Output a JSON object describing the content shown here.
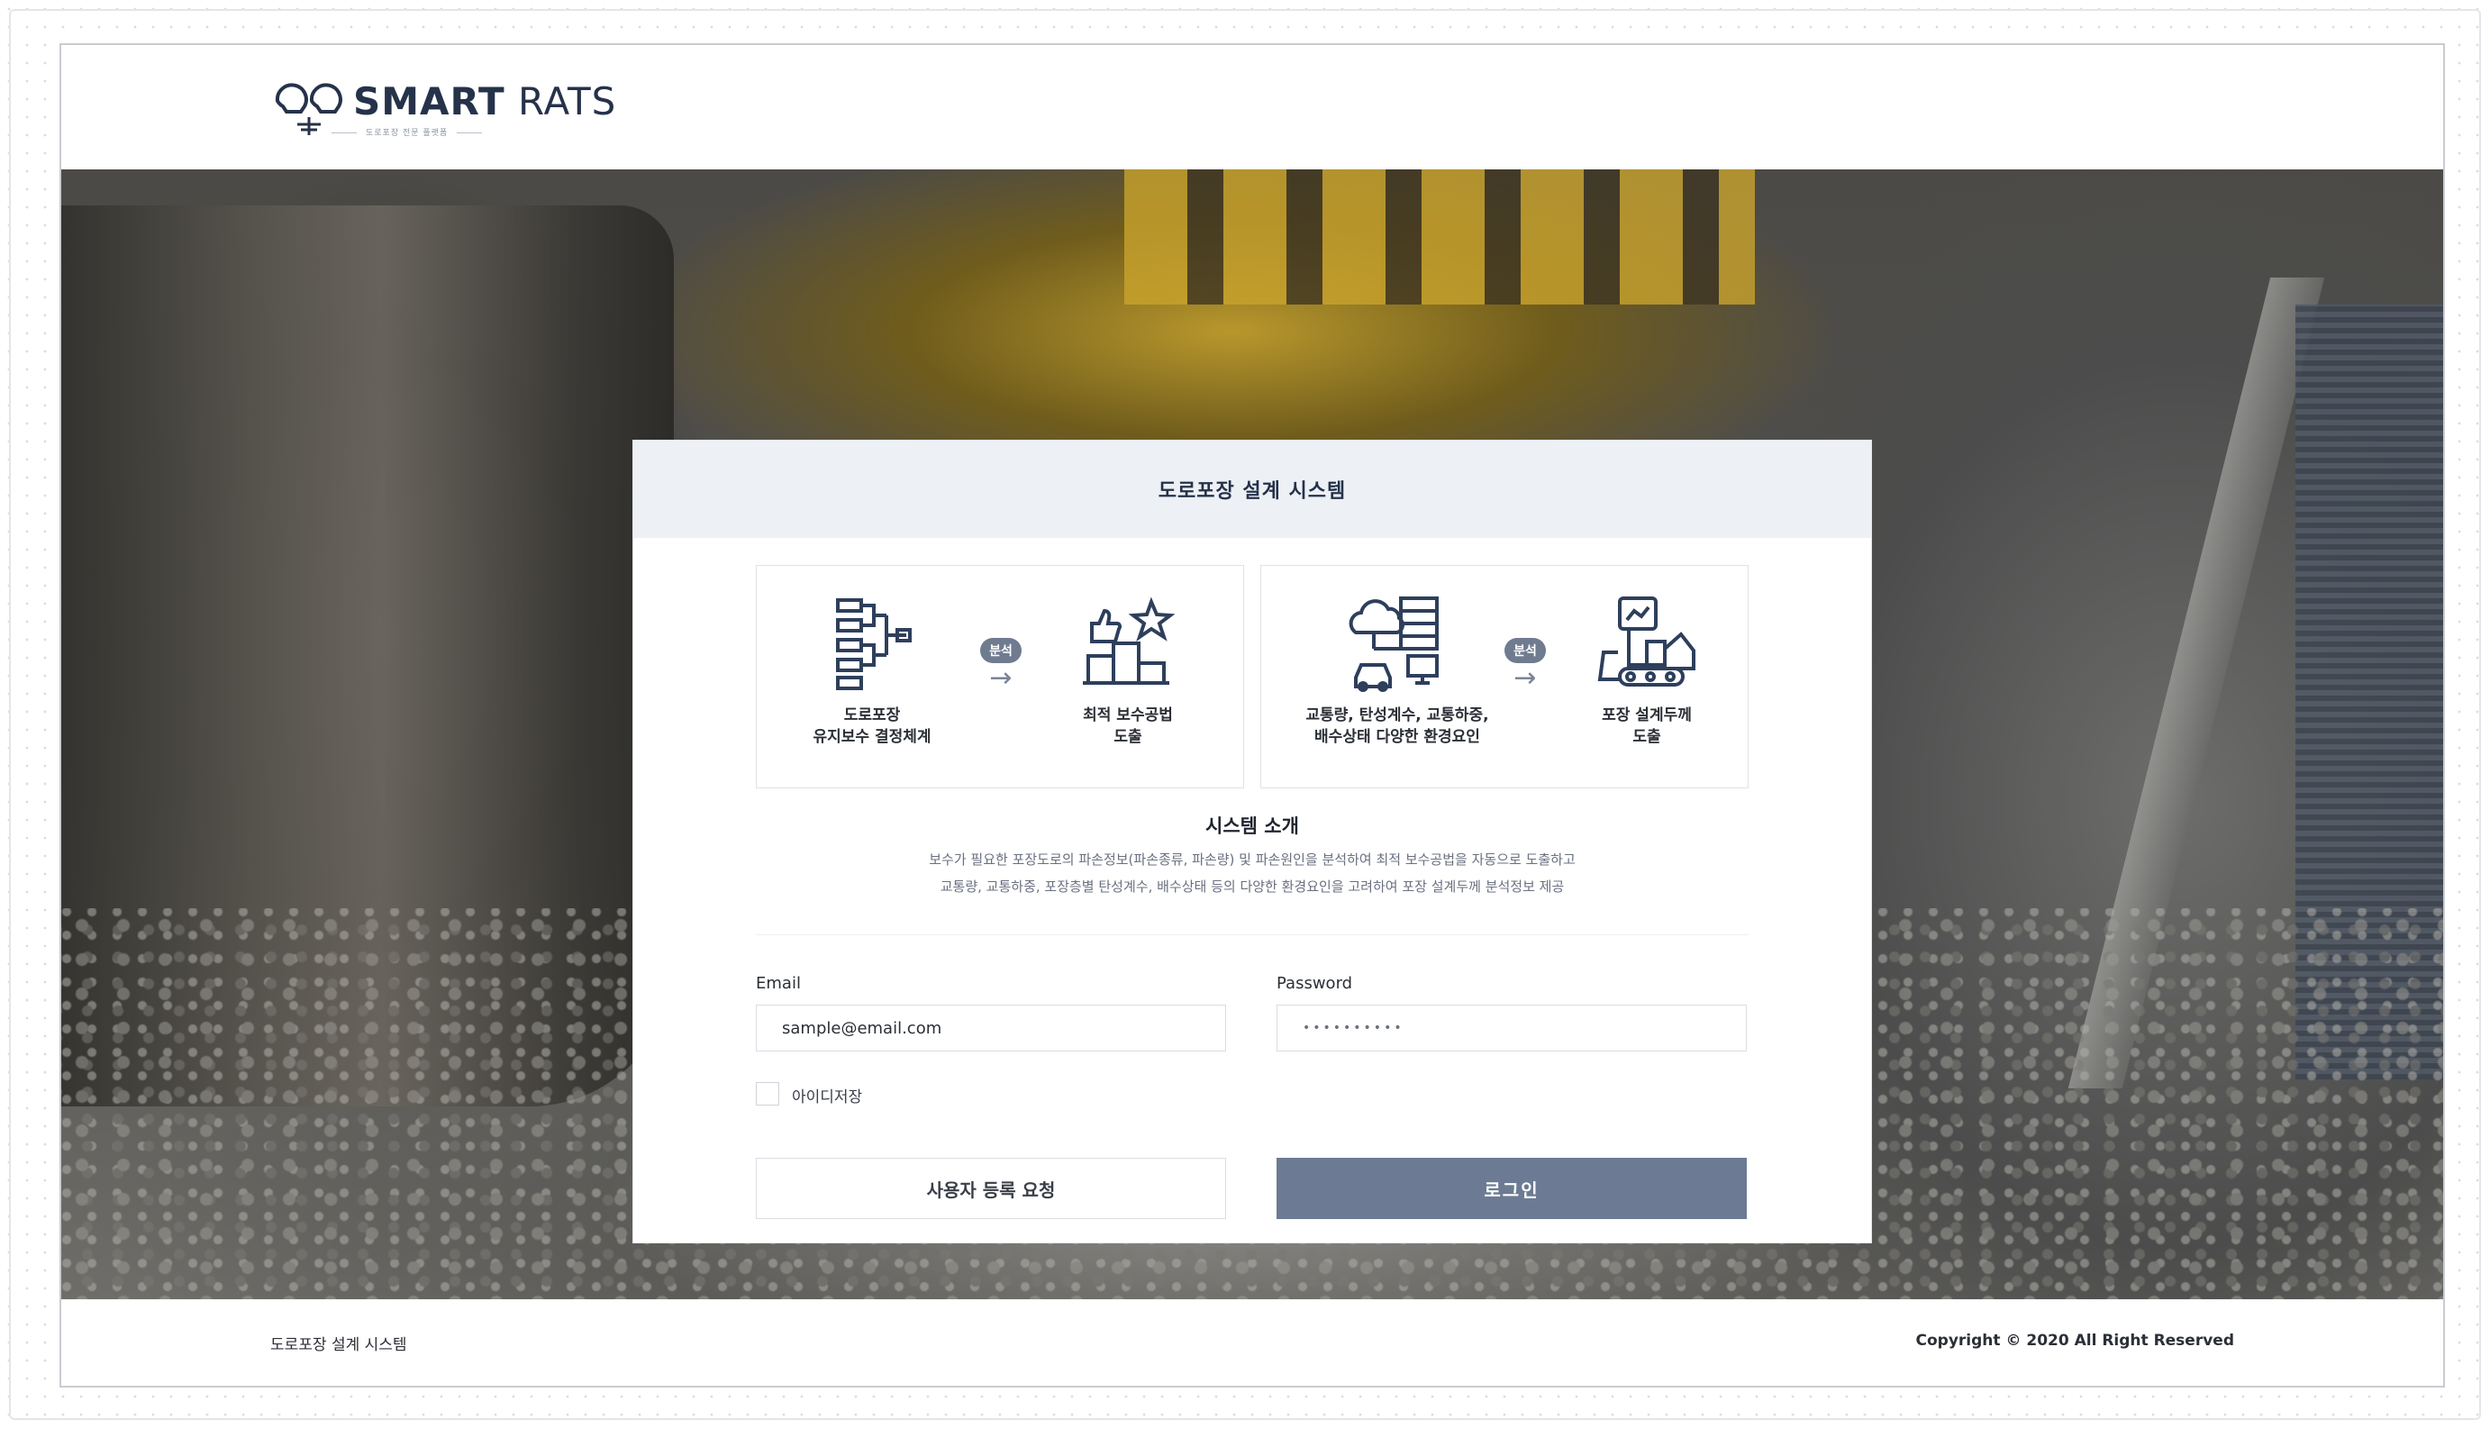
{
  "brand": {
    "name_bold": "SMART",
    "name_light": "RATS",
    "tagline": "도로포장 전문 플랫폼"
  },
  "card": {
    "title": "도로포장 설계 시스템",
    "flows": [
      {
        "from": {
          "icon": "hierarchy-chart-icon",
          "caption_1": "도로포장",
          "caption_2": "유지보수 결정체계"
        },
        "arrow_label": "분석",
        "to": {
          "icon": "podium-star-icon",
          "caption_1": "최적 보수공법",
          "caption_2": "도출"
        }
      },
      {
        "from": {
          "icon": "cloud-server-car-icon",
          "caption_1": "교통량, 탄성계수, 교통하중,",
          "caption_2": "배수상태 다양한 환경요인"
        },
        "arrow_label": "분석",
        "to": {
          "icon": "bulldozer-icon",
          "caption_1": "포장 설계두께",
          "caption_2": "도출"
        }
      }
    ],
    "intro": {
      "title": "시스템 소개",
      "line_1": "보수가 필요한 포장도로의 파손정보(파손종류, 파손량) 및 파손원인을 분석하여 최적 보수공법을 자동으로 도출하고",
      "line_2": "교통량, 교통하중, 포장층별 탄성계수, 배수상태 등의 다양한 환경요인을 고려하여 포장 설계두께 분석정보 제공"
    },
    "form": {
      "email_label": "Email",
      "email_value": "sample@email.com",
      "password_label": "Password",
      "password_value": "••••••••••",
      "remember_label": "아이디저장",
      "remember_checked": false,
      "register_button": "사용자 등록 요청",
      "login_button": "로그인"
    }
  },
  "footer": {
    "left": "도로포장 설계 시스템",
    "right": "Copyright © 2020  All Right Reserved"
  },
  "colors": {
    "primary_button": "#6c7b93",
    "brand_text": "#25324a",
    "card_header_bg": "#edf0f4"
  }
}
